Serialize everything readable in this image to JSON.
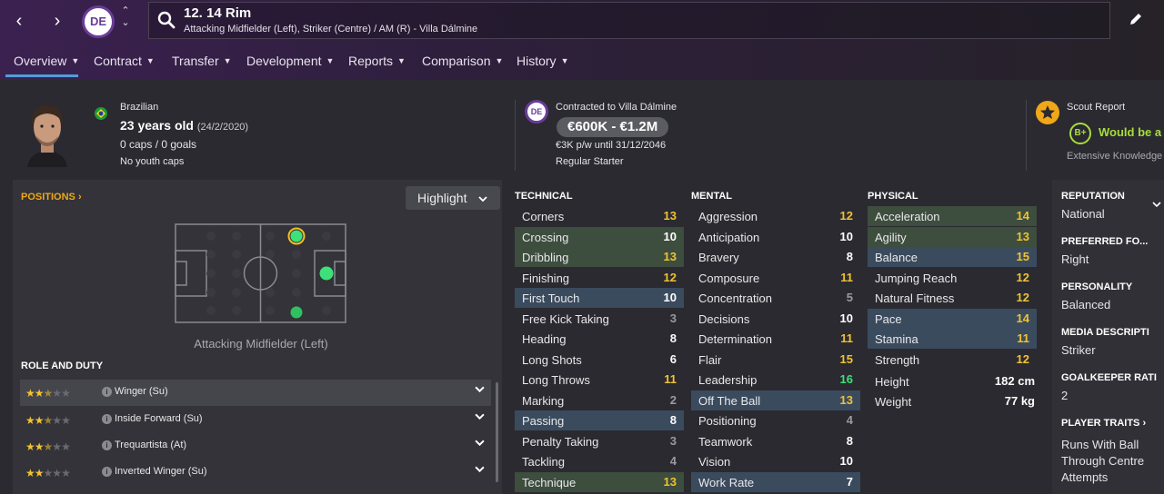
{
  "header": {
    "player_title": "12. 14 Rim",
    "player_subtitle": "Attacking Midfielder (Left), Striker (Centre) / AM (R) - Villa Dálmine",
    "club_initials": "DE"
  },
  "tabs": [
    {
      "label": "Overview",
      "active": true
    },
    {
      "label": "Contract"
    },
    {
      "label": "Transfer"
    },
    {
      "label": "Development"
    },
    {
      "label": "Reports"
    },
    {
      "label": "Comparison"
    },
    {
      "label": "History"
    }
  ],
  "info": {
    "nationality": "Brazilian",
    "age": "23 years old",
    "dob": "(24/2/2020)",
    "caps": "0 caps / 0 goals",
    "youth_caps": "No youth caps",
    "contract_club": "Contracted to Villa Dálmine",
    "value": "€600K - €1.2M",
    "wage": "€3K p/w until 31/12/2046",
    "squad_status": "Regular Starter",
    "scout_title": "Scout Report",
    "scout_grade": "B+",
    "scout_verdict": "Would be a s",
    "scout_knowledge": "Extensive Knowledge"
  },
  "positions": {
    "heading": "POSITIONS",
    "highlight_label": "Highlight",
    "selected_position": "Attacking Midfielder (Left)"
  },
  "roles": {
    "heading": "ROLE AND DUTY",
    "items": [
      {
        "name": "Winger (Su)",
        "stars": 2.5
      },
      {
        "name": "Inside Forward (Su)",
        "stars": 2.5
      },
      {
        "name": "Trequartista (At)",
        "stars": 2.5
      },
      {
        "name": "Inverted Winger (Su)",
        "stars": 2
      }
    ]
  },
  "attributes": {
    "technical_heading": "TECHNICAL",
    "mental_heading": "MENTAL",
    "physical_heading": "PHYSICAL",
    "technical": [
      {
        "name": "Corners",
        "value": "13"
      },
      {
        "name": "Crossing",
        "value": "10",
        "hl": "green"
      },
      {
        "name": "Dribbling",
        "value": "13",
        "hl": "green"
      },
      {
        "name": "Finishing",
        "value": "12"
      },
      {
        "name": "First Touch",
        "value": "10",
        "hl": "blue"
      },
      {
        "name": "Free Kick Taking",
        "value": "3"
      },
      {
        "name": "Heading",
        "value": "8"
      },
      {
        "name": "Long Shots",
        "value": "6"
      },
      {
        "name": "Long Throws",
        "value": "11"
      },
      {
        "name": "Marking",
        "value": "2"
      },
      {
        "name": "Passing",
        "value": "8",
        "hl": "blue"
      },
      {
        "name": "Penalty Taking",
        "value": "3"
      },
      {
        "name": "Tackling",
        "value": "4"
      },
      {
        "name": "Technique",
        "value": "13",
        "hl": "green"
      }
    ],
    "mental": [
      {
        "name": "Aggression",
        "value": "12"
      },
      {
        "name": "Anticipation",
        "value": "10"
      },
      {
        "name": "Bravery",
        "value": "8"
      },
      {
        "name": "Composure",
        "value": "11"
      },
      {
        "name": "Concentration",
        "value": "5"
      },
      {
        "name": "Decisions",
        "value": "10"
      },
      {
        "name": "Determination",
        "value": "11"
      },
      {
        "name": "Flair",
        "value": "15"
      },
      {
        "name": "Leadership",
        "value": "16"
      },
      {
        "name": "Off The Ball",
        "value": "13",
        "hl": "blue"
      },
      {
        "name": "Positioning",
        "value": "4"
      },
      {
        "name": "Teamwork",
        "value": "8"
      },
      {
        "name": "Vision",
        "value": "10"
      },
      {
        "name": "Work Rate",
        "value": "7",
        "hl": "blue"
      }
    ],
    "physical": [
      {
        "name": "Acceleration",
        "value": "14",
        "hl": "green"
      },
      {
        "name": "Agility",
        "value": "13",
        "hl": "green"
      },
      {
        "name": "Balance",
        "value": "15",
        "hl": "blue"
      },
      {
        "name": "Jumping Reach",
        "value": "12"
      },
      {
        "name": "Natural Fitness",
        "value": "12"
      },
      {
        "name": "Pace",
        "value": "14",
        "hl": "blue"
      },
      {
        "name": "Stamina",
        "value": "11",
        "hl": "blue"
      },
      {
        "name": "Strength",
        "value": "12"
      }
    ],
    "height_label": "Height",
    "height_value": "182 cm",
    "weight_label": "Weight",
    "weight_value": "77 kg"
  },
  "side": {
    "reputation_h": "REPUTATION",
    "reputation_v": "National",
    "foot_h": "PREFERRED FO...",
    "foot_v": "Right",
    "personality_h": "PERSONALITY",
    "personality_v": "Balanced",
    "media_h": "MEDIA DESCRIPTI",
    "media_v": "Striker",
    "gk_h": "GOALKEEPER RATI",
    "gk_v": "2",
    "traits_h": "PLAYER TRAITS",
    "trait1": "Runs With Ball",
    "trait2": "Through Centre",
    "trait3": "Attempts"
  },
  "colors": {
    "accent_orange": "#f0a818",
    "value_yellow": "#f1c232",
    "value_green": "#3ee07a",
    "value_grey": "#9a9aa0",
    "hl_green": "#3d4d3e",
    "hl_blue": "#3b4b5e",
    "tab_active": "#4f9ed8"
  },
  "icons": [
    "back-arrow-icon",
    "forward-arrow-icon",
    "search-icon",
    "edit-icon",
    "brazil-flag-icon",
    "star-icon",
    "info-icon",
    "chevron-down-icon"
  ]
}
